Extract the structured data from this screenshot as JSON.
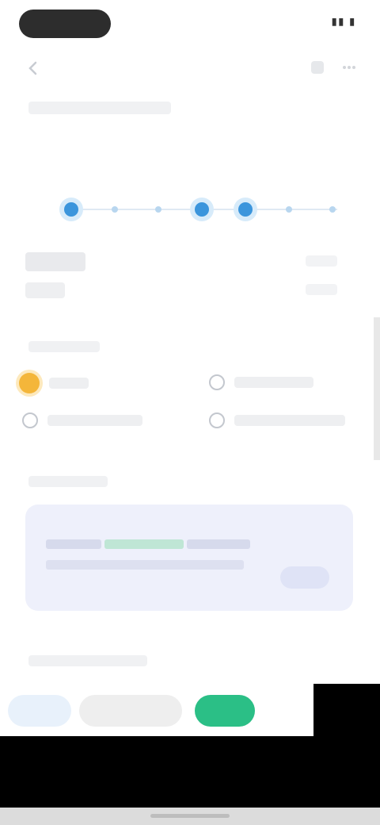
{
  "colors": {
    "accent_blue": "#3b95dc",
    "accent_green": "#2bbf86",
    "sun_yellow": "#f4b63a",
    "card_bg": "#eef0fb"
  },
  "status_bar": {
    "time_pill": "",
    "indicators": "▮▮ ▮"
  },
  "header": {
    "back_icon": "back-arrow-icon",
    "title": "",
    "actions": [
      "share-icon",
      "more-icon"
    ]
  },
  "timeline": {
    "label": "",
    "points": [
      {
        "state": "active"
      },
      {
        "state": "inactive"
      },
      {
        "state": "inactive"
      },
      {
        "state": "active"
      },
      {
        "state": "active"
      },
      {
        "state": "inactive"
      },
      {
        "state": "inactive"
      }
    ]
  },
  "info": {
    "primary_value": "",
    "secondary_value": "",
    "side_value_1": "",
    "side_value_2": ""
  },
  "attributes": {
    "label": "",
    "items": [
      {
        "icon": "sun-icon",
        "text": ""
      },
      {
        "icon": "circle-icon",
        "text": ""
      },
      {
        "icon": "circle-icon",
        "text": ""
      },
      {
        "icon": "circle-icon",
        "text": ""
      }
    ]
  },
  "tips": {
    "label": "",
    "card_text": "",
    "card_link": "",
    "card_button": ""
  },
  "related": {
    "label": "",
    "chips": [
      "",
      "",
      ""
    ]
  }
}
